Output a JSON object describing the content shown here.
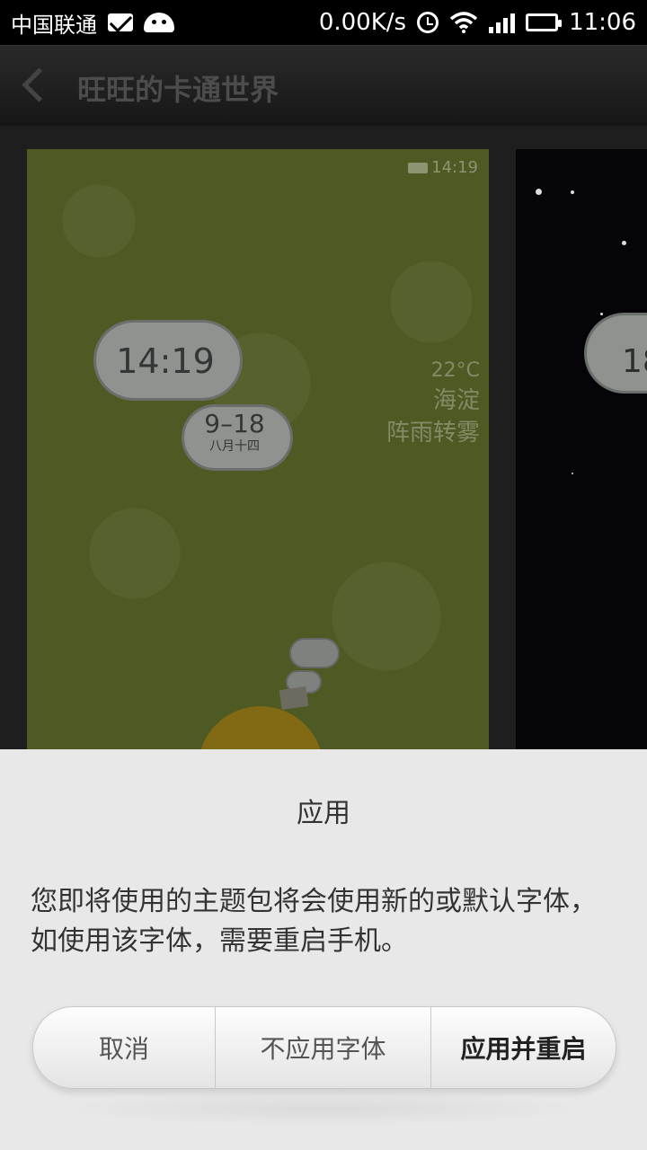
{
  "status_bar": {
    "carrier": "中国联通",
    "speed": "0.00K/s",
    "time": "11:06"
  },
  "header": {
    "title": "旺旺的卡通世界"
  },
  "preview": {
    "mini_time": "14:19",
    "clock": "14:19",
    "date": "9–18",
    "lunar": "八月十四",
    "temperature": "22°C",
    "location": "海淀",
    "condition": "阵雨转雾",
    "right_clock": "18"
  },
  "dialog": {
    "title": "应用",
    "message": "您即将使用的主题包将会使用新的或默认字体，如使用该字体，需要重启手机。",
    "buttons": {
      "cancel": "取消",
      "no_font": "不应用字体",
      "apply_restart": "应用并重启"
    }
  }
}
